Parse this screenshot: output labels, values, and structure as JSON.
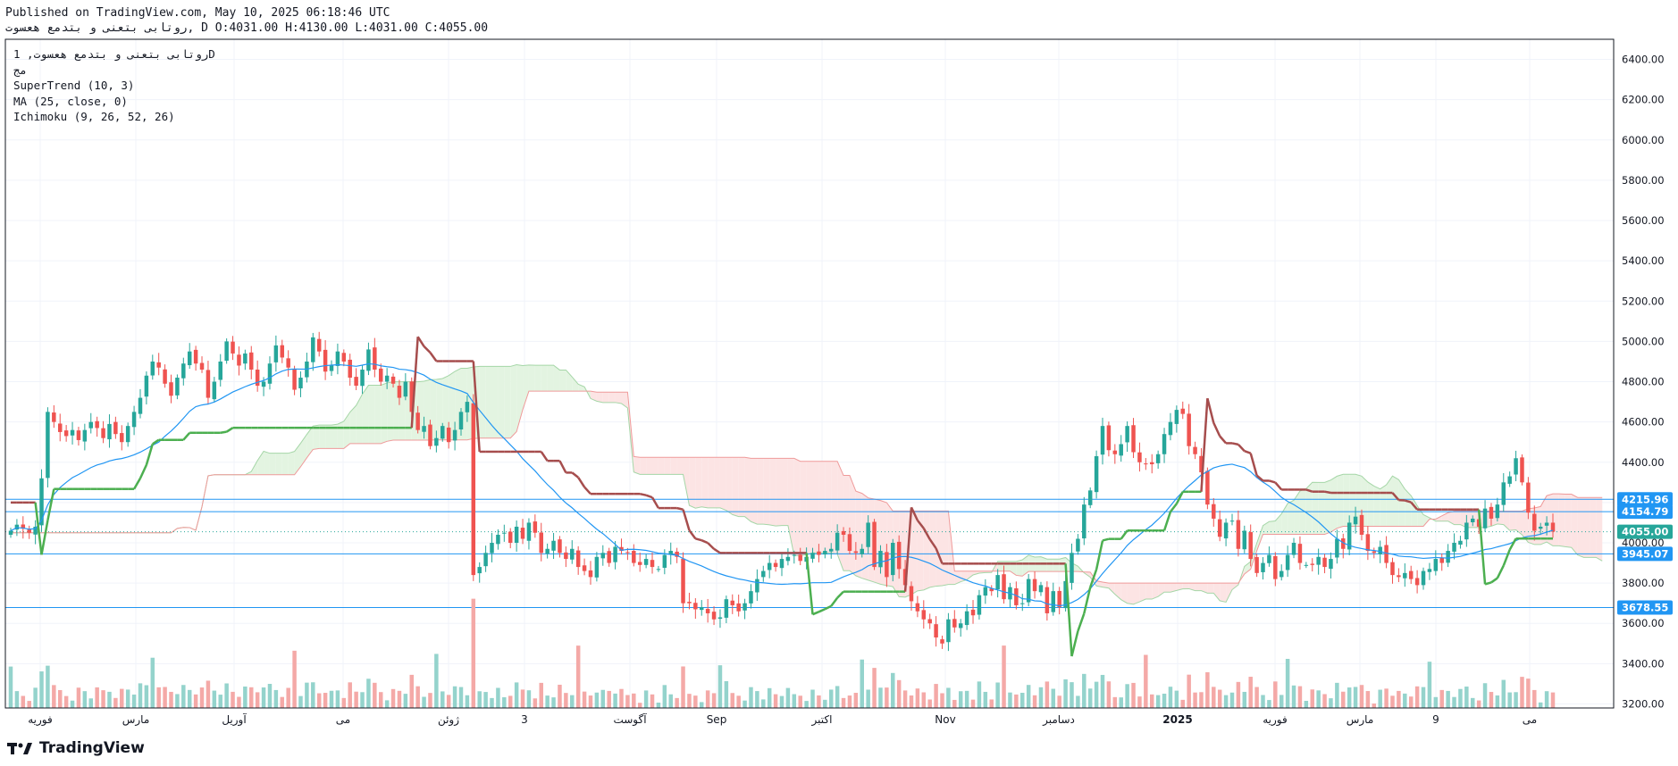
{
  "header": {
    "published": "Published on TradingView.com, May 10, 2025 06:18:46 UTC",
    "symbol_line": "روتابی بتعنی و بتدمع هعسوت, D O:4031.00 H:4130.00 L:4031.00 C:4055.00"
  },
  "legend": {
    "symbol": "روتابی بتعنی و بتدمع هعسوت, 1D",
    "exchange": "مج",
    "supertrend": "SuperTrend (10, 3)",
    "ma": "MA (25, close, 0)",
    "ichimoku": "Ichimoku (9, 26, 52, 26)"
  },
  "brand": {
    "name": "TradingView",
    "icon": "tradingview-logo-icon"
  },
  "colors": {
    "up": "#26a69a",
    "down": "#ef5350",
    "up_volume": "#94d3cc",
    "down_volume": "#f4a9a7",
    "supertrend_down": "#a64d4d",
    "supertrend_up": "#4caf50",
    "ma": "#2196f3",
    "hline": "#2196f3",
    "cloud_bear": "#fce4e4",
    "cloud_bull": "#e3f4e1",
    "last_price": "#26a69a",
    "grid": "#f0f3fa",
    "axis_text": "#131722"
  },
  "chart_data": {
    "type": "candlestick",
    "y_axis": {
      "range": [
        3180,
        6500
      ],
      "ticks": [
        "6400.00",
        "6200.00",
        "6000.00",
        "5800.00",
        "5600.00",
        "5400.00",
        "5200.00",
        "5000.00",
        "4800.00",
        "4600.00",
        "4400.00",
        "4200.00",
        "4000.00",
        "3800.00",
        "3600.00",
        "3400.00",
        "3200.00"
      ]
    },
    "x_axis": {
      "labels": [
        "فوریه",
        "مارس",
        "آوریل",
        "می",
        "ژوئن",
        "3",
        "آگوست",
        "Sep",
        "اکتبر",
        "Nov",
        "دسامبر",
        "2025",
        "فوریه",
        "مارس",
        "9",
        "می"
      ]
    },
    "price_labels": [
      {
        "value": "4215.96",
        "kind": "line"
      },
      {
        "value": "4154.79",
        "kind": "line"
      },
      {
        "value": "4055.00",
        "kind": "last"
      },
      {
        "value": "3945.07",
        "kind": "line"
      },
      {
        "value": "3678.55",
        "kind": "line"
      }
    ],
    "horizontal_lines": [
      4215.96,
      4154.79,
      3945.07,
      3678.55
    ],
    "last_price": 4055.0,
    "close_series": [
      4060,
      4090,
      4070,
      4050,
      4080,
      4320,
      4650,
      4600,
      4550,
      4530,
      4560,
      4510,
      4560,
      4600,
      4570,
      4520,
      4590,
      4540,
      4500,
      4580,
      4650,
      4720,
      4830,
      4900,
      4870,
      4790,
      4730,
      4820,
      4890,
      4950,
      4890,
      4860,
      4720,
      4800,
      4900,
      5000,
      4940,
      4880,
      4940,
      4860,
      4780,
      4800,
      4890,
      4980,
      4920,
      4870,
      4760,
      4820,
      4900,
      5020,
      4950,
      4850,
      4880,
      4950,
      4900,
      4820,
      4780,
      4860,
      4960,
      4860,
      4800,
      4830,
      4790,
      4720,
      4800,
      4650,
      4560,
      4580,
      4480,
      4520,
      4580,
      4500,
      4560,
      4650,
      4700,
      3840,
      3880,
      3950,
      4000,
      4040,
      4050,
      4000,
      4080,
      4020,
      4100,
      4050,
      3950,
      3970,
      4010,
      3950,
      3920,
      3970,
      3880,
      3860,
      3830,
      3930,
      3950,
      3900,
      3980,
      3960,
      3950,
      3900,
      3890,
      3920,
      3880,
      3870,
      3940,
      3960,
      3930,
      3700,
      3700,
      3670,
      3680,
      3650,
      3620,
      3630,
      3720,
      3690,
      3660,
      3700,
      3760,
      3820,
      3860,
      3900,
      3880,
      3920,
      3930,
      3940,
      3910,
      3930,
      3950,
      3940,
      3960,
      3970,
      4050,
      4040,
      3960,
      3950,
      3970,
      4100,
      3880,
      3960,
      3830,
      4000,
      3870,
      3790,
      3710,
      3660,
      3620,
      3600,
      3530,
      3500,
      3620,
      3580,
      3600,
      3660,
      3640,
      3740,
      3780,
      3760,
      3840,
      3720,
      3780,
      3690,
      3700,
      3820,
      3760,
      3790,
      3650,
      3760,
      3680,
      3810,
      3950,
      4020,
      4190,
      4260,
      4430,
      4580,
      4460,
      4440,
      4490,
      4580,
      4450,
      4400,
      4390,
      4390,
      4440,
      4540,
      4600,
      4660,
      4640,
      4480,
      4440,
      4350,
      4190,
      4120,
      4030,
      4100,
      4110,
      3970,
      4060,
      3920,
      3850,
      3900,
      3940,
      3820,
      3860,
      3940,
      4000,
      3900,
      3890,
      3890,
      3930,
      3880,
      3920,
      4020,
      3970,
      4100,
      4130,
      4040,
      3960,
      3950,
      3980,
      3900,
      3840,
      3830,
      3850,
      3820,
      3790,
      3860,
      3870,
      3920,
      3900,
      3960,
      4000,
      4010,
      4100,
      4120,
      4080,
      4170,
      4120,
      4190,
      4300,
      4330,
      4420,
      4300,
      4150,
      4060,
      4080,
      4100,
      4055
    ]
  }
}
